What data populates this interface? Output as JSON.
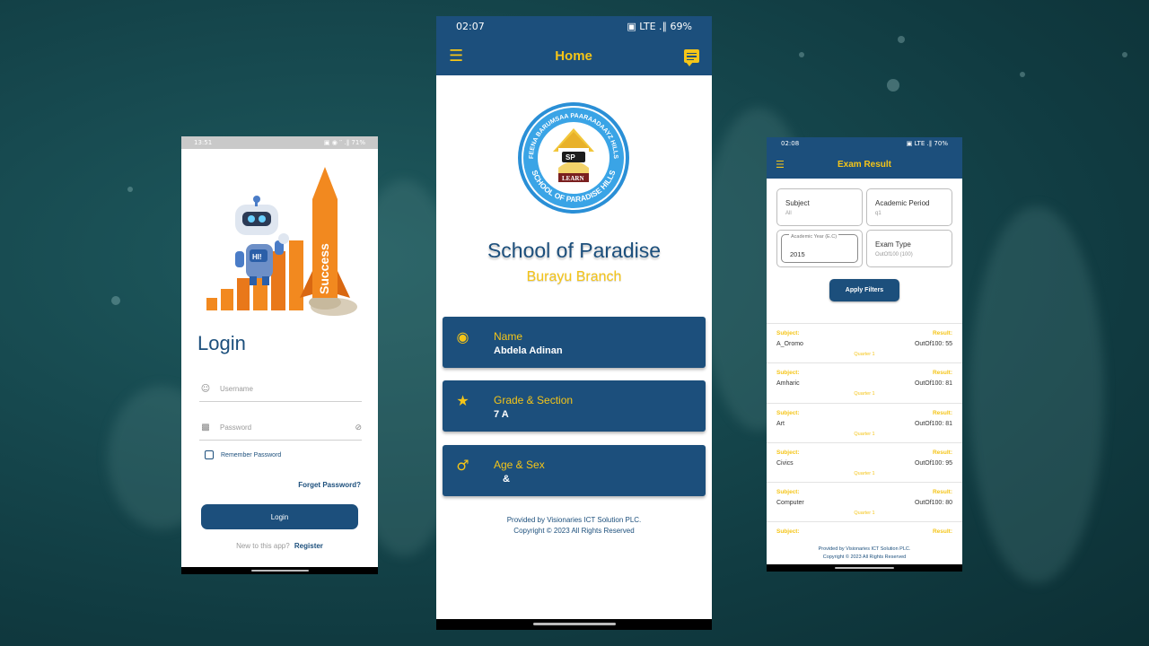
{
  "login_screen": {
    "status_time": "13:51",
    "status_icons_left": "▣ ◂ ▣ •",
    "status_right": "▣ ◉ ′′ .∥ 71%",
    "hero_text": "Success",
    "hero_badge": "HI!",
    "title": "Login",
    "username_placeholder": "Username",
    "password_placeholder": "Password",
    "remember_label": "Remember Password",
    "forgot_label": "Forget Password?",
    "login_button": "Login",
    "new_user_text": "New to this app?",
    "register_link": "Register"
  },
  "home_screen": {
    "status_time": "02:07",
    "status_right": "▣ LTE .∥ 69%",
    "title": "Home",
    "logo_text_top": "FEENA BARUMSAA PAARAADAAYZ HILLS",
    "logo_text_bottom": "SCHOOL OF PARADISE HILLS",
    "logo_initials": "SP",
    "logo_motto": "LEARN",
    "school_name": "School of Paradise",
    "branch_name": "Burayu Branch",
    "cards": [
      {
        "icon": "account-circle-icon",
        "label": "Name",
        "value": "Abdela Adinan"
      },
      {
        "icon": "star-icon",
        "label": "Grade & Section",
        "value": "7 A"
      },
      {
        "icon": "male-icon",
        "label": "Age & Sex",
        "value": "&"
      }
    ],
    "footer_line1": "Provided by Visionaries ICT Solution PLC.",
    "footer_line2": "Copyright © 2023 All Rights Reserved"
  },
  "exam_screen": {
    "status_time": "02:08",
    "status_right": "▣ LTE .∥ 70%",
    "title": "Exam Result",
    "filters": {
      "subject_label": "Subject",
      "subject_value": "All",
      "period_label": "Academic Period",
      "period_value": "q1",
      "year_legend": "Academic Year (E.C)",
      "year_value": "2015",
      "type_label": "Exam Type",
      "type_value": "OutOf100 (100)"
    },
    "apply_button": "Apply Filters",
    "subject_label": "Subject:",
    "result_label": "Result:",
    "results": [
      {
        "subject": "A_Oromo",
        "result": "OutOf100: 55",
        "quarter": "Quarter 1"
      },
      {
        "subject": "Amharic",
        "result": "OutOf100: 81",
        "quarter": "Quarter 1"
      },
      {
        "subject": "Art",
        "result": "OutOf100: 81",
        "quarter": "Quarter 1"
      },
      {
        "subject": "Civics",
        "result": "OutOf100: 95",
        "quarter": "Quarter 1"
      },
      {
        "subject": "Computer",
        "result": "OutOf100: 80",
        "quarter": "Quarter 1"
      },
      {
        "subject": "",
        "result": "",
        "quarter": ""
      }
    ],
    "footer_line1": "Provided by Visionaries ICT Solution PLC.",
    "footer_line2": "Copyright © 2023 All Rights Reserved"
  },
  "colors": {
    "primary": "#1c4f7c",
    "accent": "#f5c518",
    "background": "#174a50"
  }
}
